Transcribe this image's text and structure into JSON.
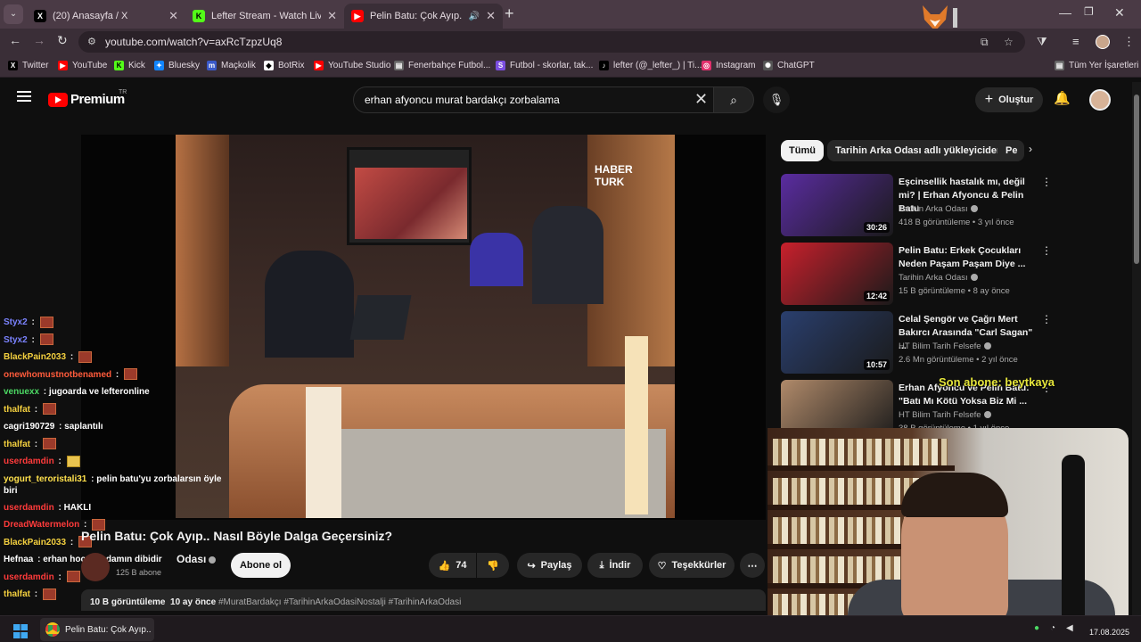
{
  "browser": {
    "tabs": [
      {
        "title": "(20) Anasayfa / X",
        "favicon": "x-icon",
        "active": false
      },
      {
        "title": "Lefter Stream - Watch Live on K",
        "favicon": "kick-icon",
        "active": false
      },
      {
        "title": "Pelin Batu: Çok Ayıp.. Nasıl",
        "favicon": "youtube-icon",
        "active": true
      }
    ],
    "url": "youtube.com/watch?v=axRcTzpzUq8",
    "bookmarks": [
      {
        "label": "Twitter",
        "icon": "x-icon",
        "color": "#000000"
      },
      {
        "label": "YouTube",
        "icon": "youtube-icon",
        "color": "#ff0000"
      },
      {
        "label": "Kick",
        "icon": "kick-icon",
        "color": "#53fc18"
      },
      {
        "label": "Bluesky",
        "icon": "bluesky-icon",
        "color": "#1185fe"
      },
      {
        "label": "Maçkolik",
        "icon": "mackolik-icon",
        "color": "#3a59c9"
      },
      {
        "label": "BotRix",
        "icon": "botrix-icon",
        "color": "#ffffff"
      },
      {
        "label": "YouTube Studio",
        "icon": "youtube-studio-icon",
        "color": "#ff0000"
      },
      {
        "label": "Fenerbahçe Futbol...",
        "icon": "folder-icon",
        "color": "#cccccc"
      },
      {
        "label": "Futbol - skorlar, tak...",
        "icon": "flashscore-icon",
        "color": "#7b4ee0"
      },
      {
        "label": "lefter (@_lefter_) | Ti...",
        "icon": "tiktok-icon",
        "color": "#000000"
      },
      {
        "label": "Instagram",
        "icon": "instagram-icon",
        "color": "#e1306c"
      },
      {
        "label": "ChatGPT",
        "icon": "chatgpt-icon",
        "color": "#ffffff"
      }
    ],
    "all_bookmarks_label": "Tüm Yer İşaretleri"
  },
  "youtube": {
    "brand": "Premium",
    "country": "TR",
    "search_query": "erhan afyoncu murat bardakçı zorbalama",
    "create_label": "Oluştur",
    "video": {
      "title": "Pelin Batu: Çok Ayıp.. Nasıl Böyle Dalga Geçersiniz?",
      "channel": "Tarihin Arka Odası",
      "channel_name_visible": "Odası",
      "subscribers": "125 B abone",
      "subscribe_label": "Abone ol",
      "likes": "74",
      "share_label": "Paylaş",
      "download_label": "İndir",
      "thanks_label": "Teşekkürler",
      "views": "10 B görüntüleme",
      "age": "10 ay önce",
      "tags": "#MuratBardakçı #TarihinArkaOdasiNostalji #TarihinArkaOdasi",
      "broadcast_logo_line1": "HABER",
      "broadcast_logo_line2": "TURK"
    },
    "chips": [
      {
        "label": "Tümü",
        "active": true
      },
      {
        "label": "Tarihin Arka Odası adlı yükleyiciden",
        "active": false
      },
      {
        "label": "Pe",
        "active": false
      }
    ],
    "recommendations": [
      {
        "title": "Eşcinsellik hastalık mı, değil mi? | Erhan Afyoncu & Pelin Batu",
        "channel": "Tarihin Arka Odası",
        "meta": "418 B görüntüleme • 3 yıl önce",
        "duration": "30:26",
        "thumb_color": "#5a2ca0"
      },
      {
        "title": "Pelin Batu: Erkek Çocukları Neden Paşam Paşam Diye ...",
        "channel": "Tarihin Arka Odası",
        "meta": "15 B görüntüleme • 8 ay önce",
        "duration": "12:42",
        "thumb_color": "#c8202c"
      },
      {
        "title": "Celal Şengör ve Çağrı Mert Bakırcı Arasında \"Carl Sagan\" ...",
        "channel": "HT Bilim Tarih Felsefe",
        "meta": "2.6 Mn görüntüleme • 2 yıl önce",
        "duration": "10:57",
        "thumb_color": "#2a3f6e"
      },
      {
        "title": "Erhan Afyoncu ve Pelin Batu: \"Batı Mı Kötü Yoksa Biz Mi ...",
        "channel": "HT Bilim Tarih Felsefe",
        "meta": "38 B görüntüleme • 1 yıl önce",
        "duration": "",
        "thumb_color": "#b08a6a"
      }
    ]
  },
  "stream_overlay": {
    "latest_sub_banner": "Son abone: beytkaya",
    "chat": [
      {
        "user": "Styx2",
        "color": "#7b83ff",
        "msg": "",
        "emote": "red"
      },
      {
        "user": "Styx2",
        "color": "#7b83ff",
        "msg": "",
        "emote": "red"
      },
      {
        "user": "BlackPain2033",
        "color": "#f4d03f",
        "msg": "",
        "emote": "red"
      },
      {
        "user": "onewhomustnotbenamed",
        "color": "#ff5b3b",
        "msg": "",
        "emote": "red"
      },
      {
        "user": "venuexx",
        "color": "#4cd964",
        "msg": "jugoarda ve lefteronline",
        "emote": ""
      },
      {
        "user": "thalfat",
        "color": "#f4d03f",
        "msg": "",
        "emote": "red"
      },
      {
        "user": "cagri190729",
        "color": "#ffffff",
        "msg": "saplantılı",
        "emote": ""
      },
      {
        "user": "thalfat",
        "color": "#f4d03f",
        "msg": "",
        "emote": "red"
      },
      {
        "user": "userdamdin",
        "color": "#ff3b3b",
        "msg": "",
        "emote": "gold"
      },
      {
        "user": "yogurt_teroristali31",
        "color": "#ffe14d",
        "msg": "pelin batu'yu zorbalarsın öyle biri",
        "emote": ""
      },
      {
        "user": "userdamdin",
        "color": "#ff3b3b",
        "msg": "HAKLI",
        "emote": ""
      },
      {
        "user": "DreadWatermelon",
        "color": "#ff3b3b",
        "msg": "",
        "emote": "red"
      },
      {
        "user": "BlackPain2033",
        "color": "#f4d03f",
        "msg": "",
        "emote": "red"
      },
      {
        "user": "Hefnaa",
        "color": "#ffffff",
        "msg": "erhan hocam adamın dibidir",
        "emote": ""
      },
      {
        "user": "userdamdin",
        "color": "#ff3b3b",
        "msg": "",
        "emote": "red"
      },
      {
        "user": "thalfat",
        "color": "#f4d03f",
        "msg": "",
        "emote": "red"
      }
    ]
  },
  "taskbar": {
    "app_title": "Pelin Batu: Çok Ayıp.. Na",
    "date": "17.08.2025"
  }
}
